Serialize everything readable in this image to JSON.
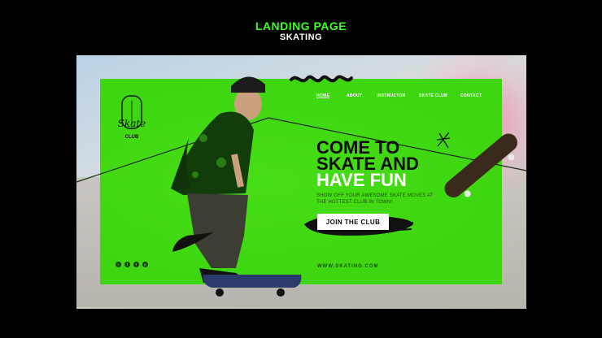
{
  "header": {
    "title": "LANDING PAGE",
    "subtitle": "SKATING"
  },
  "nav": {
    "items": [
      {
        "label": "HOME",
        "active": true
      },
      {
        "label": "ABOUT"
      },
      {
        "label": "INSTRUCTOR"
      },
      {
        "label": "SKATE CLUB"
      },
      {
        "label": "CONTACT"
      }
    ]
  },
  "logo": {
    "text": "Skate",
    "subtext": "CLUB"
  },
  "hero": {
    "line1": "COME TO",
    "line2": "SKATE AND",
    "line3": "HAVE FUN",
    "description": "SHOW OFF YOUR AWESOME SKATE MOVES AT THE HOTTEST CLUB IN TOWN!",
    "cta_label": "JOIN THE CLUB",
    "website": "WWW.SKATING.COM"
  },
  "socials": [
    {
      "icon": "instagram-icon",
      "glyph": "◎"
    },
    {
      "icon": "facebook-icon",
      "glyph": "f"
    },
    {
      "icon": "twitter-icon",
      "glyph": "t"
    },
    {
      "icon": "pinterest-icon",
      "glyph": "p"
    }
  ],
  "colors": {
    "accent": "#3ed610",
    "header_title": "#3cff1e",
    "background": "#000000",
    "text_dark": "#0c0c0c"
  }
}
